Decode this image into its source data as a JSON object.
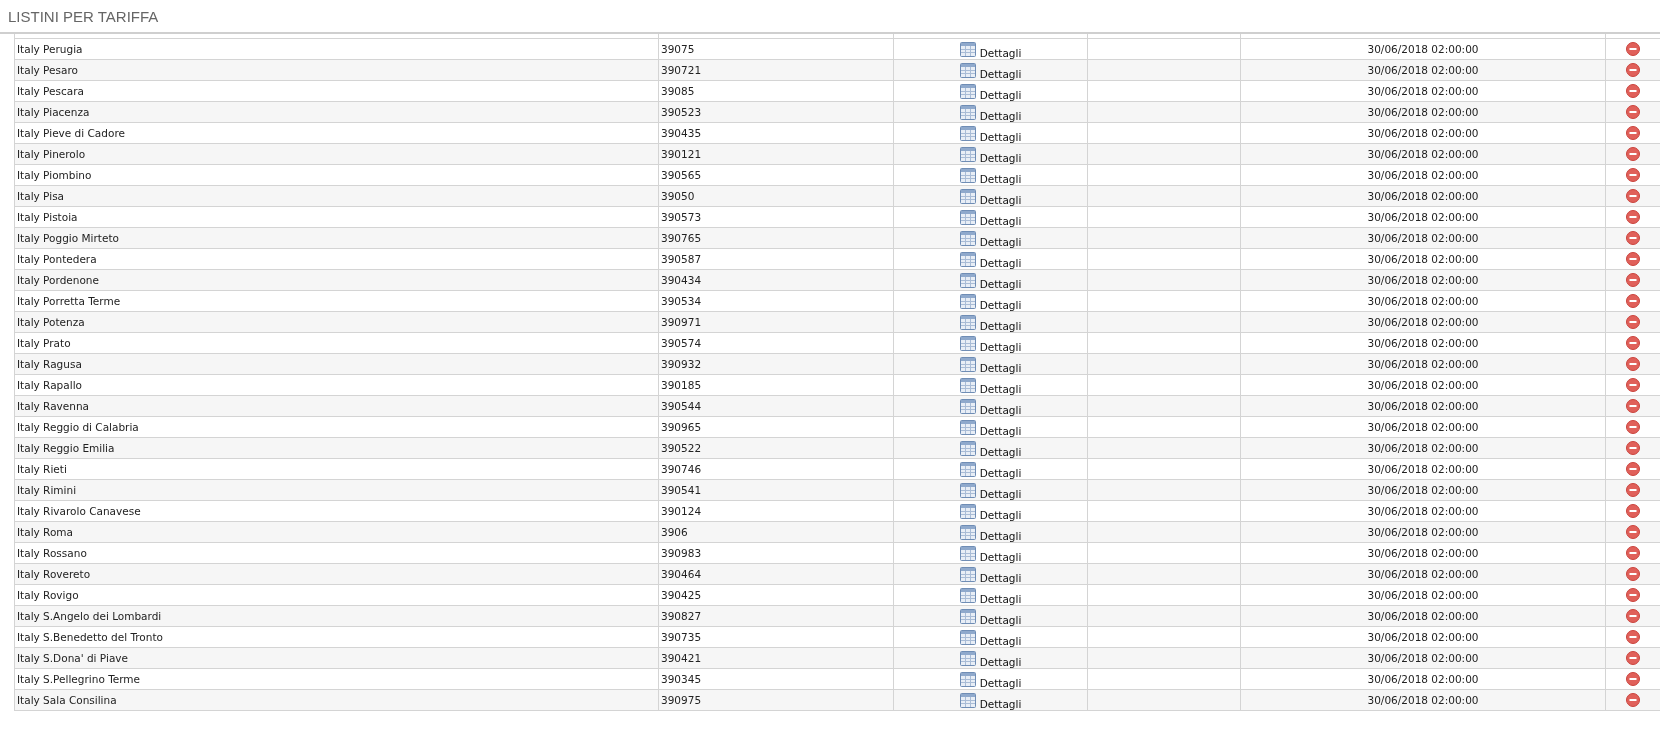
{
  "title": "LISTINI PER TARIFFA",
  "rows": [
    {
      "name": "Italy Perugia",
      "code": "39075",
      "details": "Dettagli",
      "date": "30/06/2018 02:00:00"
    },
    {
      "name": "Italy Pesaro",
      "code": "390721",
      "details": "Dettagli",
      "date": "30/06/2018 02:00:00"
    },
    {
      "name": "Italy Pescara",
      "code": "39085",
      "details": "Dettagli",
      "date": "30/06/2018 02:00:00"
    },
    {
      "name": "Italy Piacenza",
      "code": "390523",
      "details": "Dettagli",
      "date": "30/06/2018 02:00:00"
    },
    {
      "name": "Italy Pieve di Cadore",
      "code": "390435",
      "details": "Dettagli",
      "date": "30/06/2018 02:00:00"
    },
    {
      "name": "Italy Pinerolo",
      "code": "390121",
      "details": "Dettagli",
      "date": "30/06/2018 02:00:00"
    },
    {
      "name": "Italy Piombino",
      "code": "390565",
      "details": "Dettagli",
      "date": "30/06/2018 02:00:00"
    },
    {
      "name": "Italy Pisa",
      "code": "39050",
      "details": "Dettagli",
      "date": "30/06/2018 02:00:00"
    },
    {
      "name": "Italy Pistoia",
      "code": "390573",
      "details": "Dettagli",
      "date": "30/06/2018 02:00:00"
    },
    {
      "name": "Italy Poggio Mirteto",
      "code": "390765",
      "details": "Dettagli",
      "date": "30/06/2018 02:00:00"
    },
    {
      "name": "Italy Pontedera",
      "code": "390587",
      "details": "Dettagli",
      "date": "30/06/2018 02:00:00"
    },
    {
      "name": "Italy Pordenone",
      "code": "390434",
      "details": "Dettagli",
      "date": "30/06/2018 02:00:00"
    },
    {
      "name": "Italy Porretta Terme",
      "code": "390534",
      "details": "Dettagli",
      "date": "30/06/2018 02:00:00"
    },
    {
      "name": "Italy Potenza",
      "code": "390971",
      "details": "Dettagli",
      "date": "30/06/2018 02:00:00"
    },
    {
      "name": "Italy Prato",
      "code": "390574",
      "details": "Dettagli",
      "date": "30/06/2018 02:00:00"
    },
    {
      "name": "Italy Ragusa",
      "code": "390932",
      "details": "Dettagli",
      "date": "30/06/2018 02:00:00"
    },
    {
      "name": "Italy Rapallo",
      "code": "390185",
      "details": "Dettagli",
      "date": "30/06/2018 02:00:00"
    },
    {
      "name": "Italy Ravenna",
      "code": "390544",
      "details": "Dettagli",
      "date": "30/06/2018 02:00:00"
    },
    {
      "name": "Italy Reggio di Calabria",
      "code": "390965",
      "details": "Dettagli",
      "date": "30/06/2018 02:00:00"
    },
    {
      "name": "Italy Reggio Emilia",
      "code": "390522",
      "details": "Dettagli",
      "date": "30/06/2018 02:00:00"
    },
    {
      "name": "Italy Rieti",
      "code": "390746",
      "details": "Dettagli",
      "date": "30/06/2018 02:00:00"
    },
    {
      "name": "Italy Rimini",
      "code": "390541",
      "details": "Dettagli",
      "date": "30/06/2018 02:00:00"
    },
    {
      "name": "Italy Rivarolo Canavese",
      "code": "390124",
      "details": "Dettagli",
      "date": "30/06/2018 02:00:00"
    },
    {
      "name": "Italy Roma",
      "code": "3906",
      "details": "Dettagli",
      "date": "30/06/2018 02:00:00"
    },
    {
      "name": "Italy Rossano",
      "code": "390983",
      "details": "Dettagli",
      "date": "30/06/2018 02:00:00"
    },
    {
      "name": "Italy Rovereto",
      "code": "390464",
      "details": "Dettagli",
      "date": "30/06/2018 02:00:00"
    },
    {
      "name": "Italy Rovigo",
      "code": "390425",
      "details": "Dettagli",
      "date": "30/06/2018 02:00:00"
    },
    {
      "name": "Italy S.Angelo dei Lombardi",
      "code": "390827",
      "details": "Dettagli",
      "date": "30/06/2018 02:00:00"
    },
    {
      "name": "Italy S.Benedetto del Tronto",
      "code": "390735",
      "details": "Dettagli",
      "date": "30/06/2018 02:00:00"
    },
    {
      "name": "Italy S.Dona' di Piave",
      "code": "390421",
      "details": "Dettagli",
      "date": "30/06/2018 02:00:00"
    },
    {
      "name": "Italy S.Pellegrino Terme",
      "code": "390345",
      "details": "Dettagli",
      "date": "30/06/2018 02:00:00"
    },
    {
      "name": "Italy Sala Consilina",
      "code": "390975",
      "details": "Dettagli",
      "date": "30/06/2018 02:00:00"
    }
  ]
}
